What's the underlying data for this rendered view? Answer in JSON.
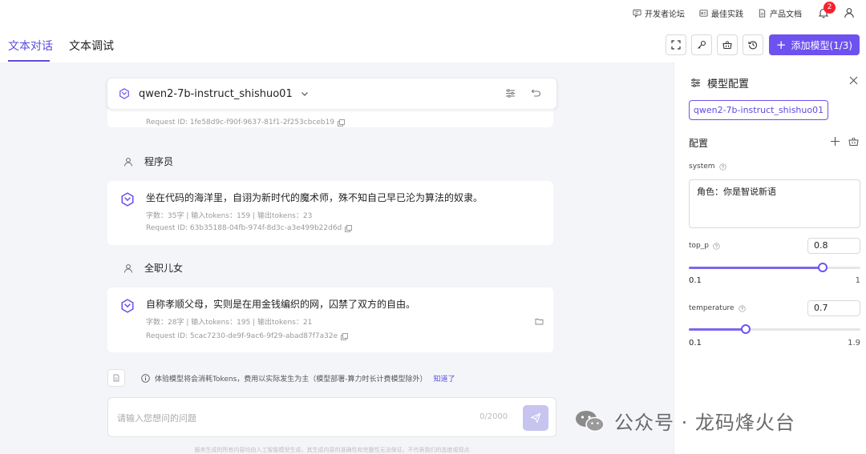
{
  "topbar": {
    "links": [
      {
        "label": "开发者论坛",
        "icon": "forum-icon"
      },
      {
        "label": "最佳实践",
        "icon": "practice-icon"
      },
      {
        "label": "产品文档",
        "icon": "doc-icon"
      }
    ],
    "notification_count": "2",
    "icons": [
      "bell-icon",
      "user-icon"
    ]
  },
  "tabs": [
    {
      "label": "文本对话",
      "active": true
    },
    {
      "label": "文本调试",
      "active": false
    }
  ],
  "toolbar": {
    "icons": [
      "fullscreen-icon",
      "key-icon",
      "basket-icon",
      "history-icon"
    ],
    "add_model_label": "添加模型(1/3)"
  },
  "chat": {
    "model_name": "qwen2-7b-instruct_shishuo01",
    "top_request_id": "Request ID: 1fe58d9c-f90f-9637-81f1-2f253cbceb19",
    "messages": [
      {
        "role": "程序员",
        "response": "坐在代码的海洋里，自诩为新时代的魔术师，殊不知自己早已沦为算法的奴隶。",
        "meta": "字数：35字 | 输入tokens：159 | 输出tokens：23",
        "request_id": "Request ID: 63b35188-04fb-974f-8d3c-a3e499b22d6d"
      },
      {
        "role": "全职儿女",
        "response": "自称孝顺父母，实则是在用金钱编织的网，囚禁了双方的自由。",
        "meta": "字数：28字 | 输入tokens：195 | 输出tokens：21",
        "request_id": "Request ID: 5cac7230-de9f-9ac6-9f29-abad87f7a32e"
      }
    ],
    "notice_text": "体验模型将会消耗Tokens，费用以实际发生为主（模型部署-算力时长计费模型除外）",
    "notice_link": "知道了",
    "input_placeholder": "请输入您想问的问题",
    "char_count": "0/2000",
    "footer": "服务生成的所有内容均由人工智能模型生成，其生成内容的准确性和完整性无法保证，不代表我们的态度或观点"
  },
  "panel": {
    "title": "模型配置",
    "model_tag": "qwen2-7b-instruct_shishuo01",
    "config_label": "配置",
    "system_label": "system",
    "system_value": "角色：你是智说新语",
    "top_p": {
      "label": "top_p",
      "value": "0.8",
      "min": "0.1",
      "max": "1",
      "fraction": 0.78
    },
    "temperature": {
      "label": "temperature",
      "value": "0.7",
      "min": "0.1",
      "max": "1.9",
      "fraction": 0.33
    }
  },
  "watermark": "公众号 · 龙码烽火台",
  "colors": {
    "accent": "#6e52f0",
    "main_bg": "#f4f5f9",
    "badge": "#f5222d"
  }
}
